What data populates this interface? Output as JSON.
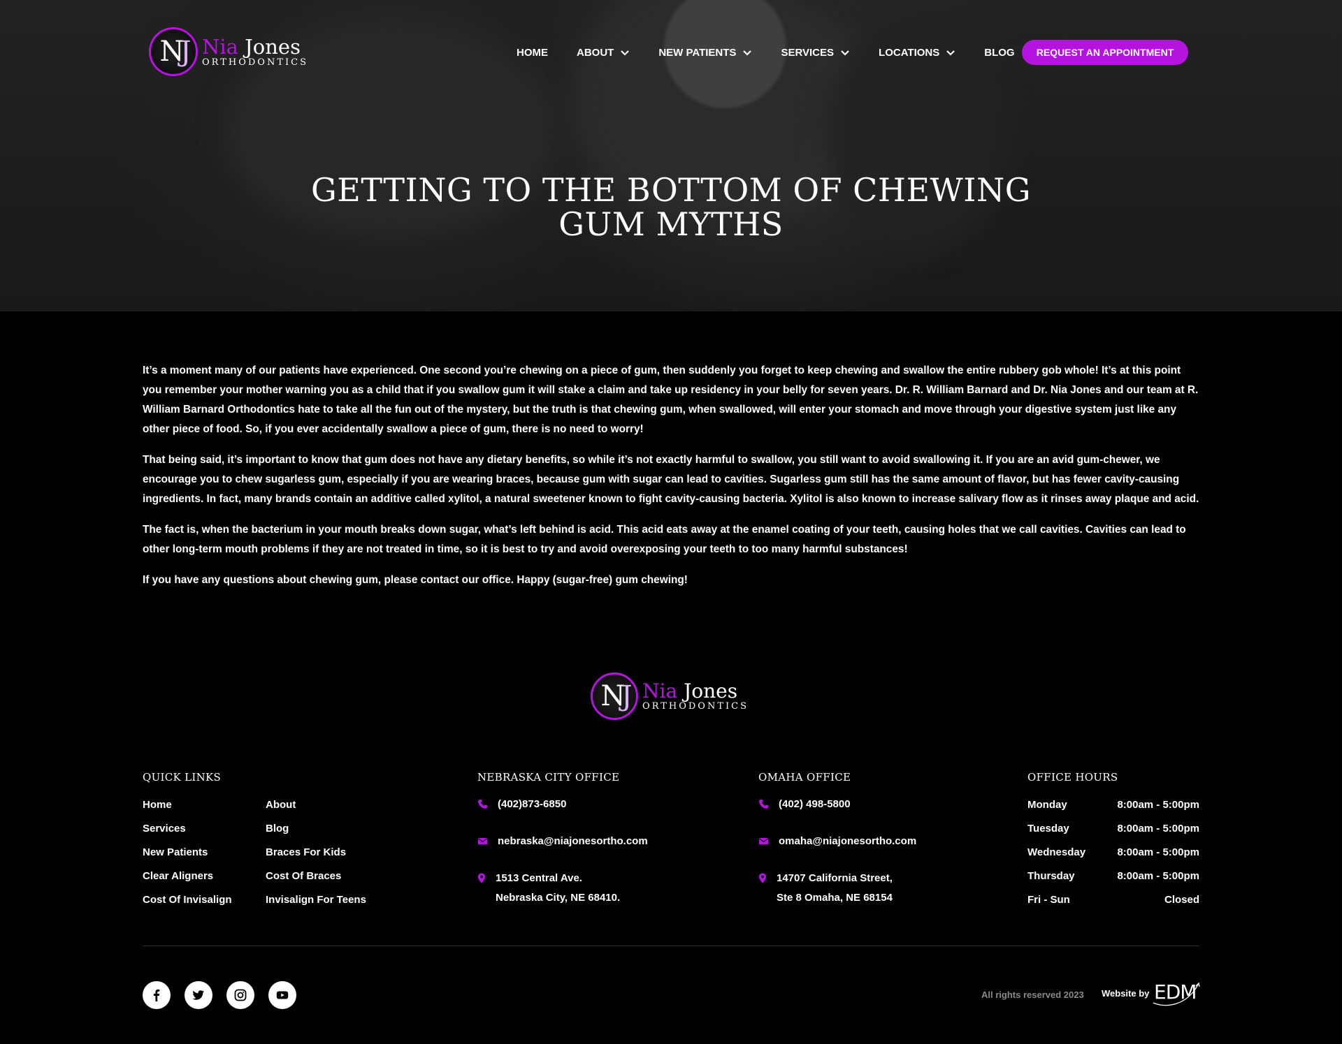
{
  "brand": {
    "name_first": "Nia",
    "name_last": "Jones",
    "tagline": "Orthodontics",
    "monogram_n": "N",
    "monogram_j": "J",
    "accent_color": "#b513e0"
  },
  "nav": {
    "items": [
      {
        "label": "HOME",
        "has_dropdown": false
      },
      {
        "label": "ABOUT",
        "has_dropdown": true
      },
      {
        "label": "NEW PATIENTS",
        "has_dropdown": true
      },
      {
        "label": "SERVICES",
        "has_dropdown": true
      },
      {
        "label": "LOCATIONS",
        "has_dropdown": true
      },
      {
        "label": "BLOG",
        "has_dropdown": false
      }
    ],
    "cta_label": "REQUEST AN APPOINTMENT"
  },
  "hero": {
    "title": "Getting to the Bottom of Chewing Gum Myths"
  },
  "article": {
    "paragraphs": [
      "It’s a moment many of our patients have experienced. One second you’re chewing on a piece of gum, then suddenly you forget to keep chewing and swallow the entire rubbery gob whole! It’s at this point you remember your mother warning you as a child that if you swallow gum it will stake a claim and take up residency in your belly for seven years. Dr. R. William Barnard and Dr. Nia Jones and our team at R. William Barnard Orthodontics hate to take all the fun out of the mystery, but the truth is that chewing gum, when swallowed, will enter your stomach and move through your digestive system just like any other piece of food. So, if you ever accidentally swallow a piece of gum, there is no need to worry!",
      "That being said, it’s important to know that gum does not have any dietary benefits, so while it’s not exactly harmful to swallow, you still want to avoid swallowing it. If you are an avid gum-chewer, we encourage you to chew sugarless gum, especially if you are wearing braces, because gum with sugar can lead to cavities. Sugarless gum still has the same amount of flavor, but has fewer cavity-causing ingredients. In fact, many brands contain an additive called xylitol, a natural sweetener known to fight cavity-causing bacteria. Xylitol is also known to increase salivary flow as it rinses away plaque and acid.",
      "The fact is, when the bacterium in your mouth breaks down sugar, what’s left behind is acid. This acid eats away at the enamel coating of your teeth, causing holes that we call cavities. Cavities can lead to other long-term mouth problems if they are not treated in time, so it is best to try and avoid overexposing your teeth to too many harmful substances!",
      "If you have any questions about chewing gum, please contact our office. Happy (sugar-free) gum chewing!"
    ]
  },
  "footer": {
    "quick_links": {
      "heading": "QUICK LINKS",
      "col1": [
        "Home",
        "Services",
        "New Patients",
        "Clear Aligners",
        "Cost Of Invisalign"
      ],
      "col2": [
        "About",
        "Blog",
        "Braces For Kids",
        "Cost Of Braces",
        "Invisalign For Teens"
      ]
    },
    "nebraska": {
      "heading": "NEBRASKA CITY OFFICE",
      "phone": "(402)873-6850",
      "email": "nebraska@niajonesortho.com",
      "address_line1": "1513 Central Ave.",
      "address_line2": "Nebraska City, NE 68410."
    },
    "omaha": {
      "heading": "OMAHA OFFICE",
      "phone": "(402) 498-5800",
      "email": "omaha@niajonesortho.com",
      "address_line1": "14707 California Street,",
      "address_line2": "Ste 8 Omaha, NE 68154"
    },
    "hours": {
      "heading": "OFFICE HOURS",
      "rows": [
        {
          "day": "Monday",
          "time": "8:00am - 5:00pm"
        },
        {
          "day": "Tuesday",
          "time": "8:00am - 5:00pm"
        },
        {
          "day": "Wednesday",
          "time": "8:00am - 5:00pm"
        },
        {
          "day": "Thursday",
          "time": "8:00am - 5:00pm"
        },
        {
          "day": "Fri - Sun",
          "time": "Closed"
        }
      ]
    },
    "social": [
      "facebook-icon",
      "twitter-icon",
      "instagram-icon",
      "youtube-icon"
    ],
    "rights": "All rights reserved 2023",
    "website_by": "Website by",
    "agency": "EDM"
  }
}
